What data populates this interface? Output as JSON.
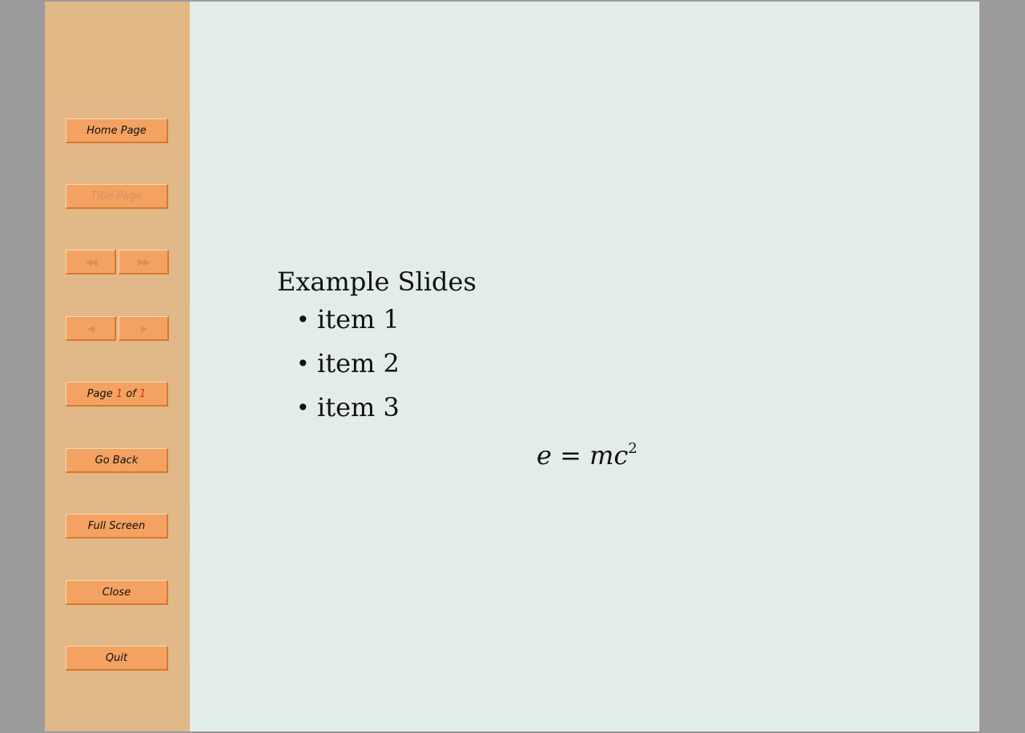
{
  "sidebar": {
    "home_label": "Home Page",
    "title_page_label": "Title Page",
    "first_glyph": "◀◀",
    "last_glyph": "▶▶",
    "prev_glyph": "◀",
    "next_glyph": "▶",
    "page_prefix": "Page ",
    "page_current": "1",
    "page_middle": " of ",
    "page_total": "1",
    "go_back_label": "Go Back",
    "full_screen_label": "Full Screen",
    "close_label": "Close",
    "quit_label": "Quit"
  },
  "slide": {
    "title": "Example Slides",
    "bullet": "•",
    "items": [
      "item 1",
      "item 2",
      "item 3"
    ],
    "equation": {
      "lhs": "e",
      "op": " = ",
      "rhs": "mc",
      "exponent": "2"
    }
  },
  "colors": {
    "viewer_bg": "#9b9b9b",
    "page_bg": "#e3ede7",
    "sidebar_bg": "#e2b786",
    "button_bg": "#f4a261",
    "accent_red": "#e8231a"
  }
}
